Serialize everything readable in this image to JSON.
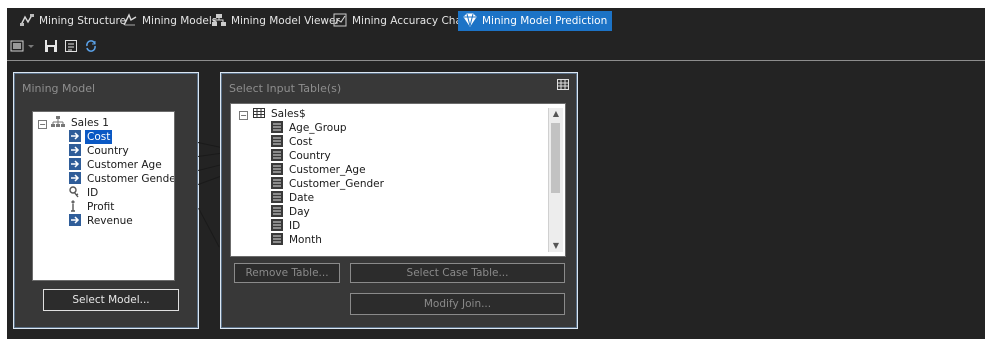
{
  "tabs": [
    {
      "label": "Mining Structure",
      "icon": "mining-structure-icon",
      "active": false
    },
    {
      "label": "Mining Models",
      "icon": "mining-models-icon",
      "active": false
    },
    {
      "label": "Mining Model Viewer",
      "icon": "model-viewer-icon",
      "active": false
    },
    {
      "label": "Mining Accuracy Chart",
      "icon": "accuracy-chart-icon",
      "active": false
    },
    {
      "label": "Mining Model Prediction",
      "icon": "prediction-icon",
      "active": true
    }
  ],
  "toolbar": {
    "items": [
      "result-view-icon",
      "dropdown-icon",
      "save-icon",
      "singleton-query-icon",
      "refresh-icon"
    ]
  },
  "mining_model": {
    "title": "Mining Model",
    "root": "Sales 1",
    "columns": [
      {
        "label": "Cost",
        "icon": "input-column-icon",
        "selected": true
      },
      {
        "label": "Country",
        "icon": "input-column-icon"
      },
      {
        "label": "Customer Age",
        "icon": "input-column-icon"
      },
      {
        "label": "Customer Gender",
        "icon": "input-column-icon"
      },
      {
        "label": "ID",
        "icon": "key-column-icon"
      },
      {
        "label": "Profit",
        "icon": "predict-column-icon"
      },
      {
        "label": "Revenue",
        "icon": "input-column-icon"
      }
    ],
    "select_button": "Select Model..."
  },
  "input_tables": {
    "title": "Select Input Table(s)",
    "root": "Sales$",
    "columns": [
      "Age_Group",
      "Cost",
      "Country",
      "Customer_Age",
      "Customer_Gender",
      "Date",
      "Day",
      "ID",
      "Month"
    ],
    "remove_button": "Remove Table...",
    "case_button": "Select Case Table...",
    "join_button": "Modify Join..."
  },
  "colors": {
    "accent": "#1c73c6",
    "background": "#232323",
    "panel": "#383838",
    "selection": "#0a58c4"
  }
}
